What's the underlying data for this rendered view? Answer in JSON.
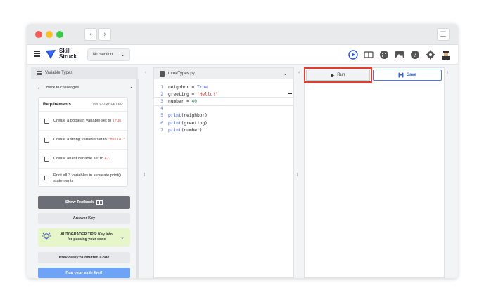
{
  "titlebar": {
    "back_glyph": "‹",
    "forward_glyph": "›",
    "menu_glyph": "☰"
  },
  "appbar": {
    "logo_line1": "Skill",
    "logo_line2": "Struck",
    "section_select": "No section",
    "brand_color": "#2250d8",
    "tool_icons": [
      "run-circle-icon",
      "book-icon",
      "palette-icon",
      "image-icon",
      "help-icon",
      "gear-icon",
      "avatar"
    ]
  },
  "left_panel": {
    "header": "Variable Types",
    "back_label": "Back to challenges",
    "requirements": {
      "title": "Requirements",
      "count": "0/4 COMPLETED",
      "items": [
        {
          "text": "Create a boolean variable set to ",
          "code": "True",
          "tail": "."
        },
        {
          "text": "Create a string variable set to ",
          "code": "\"Hello!\"",
          "tail": ""
        },
        {
          "text": "Create an int variable set to ",
          "code": "42",
          "tail": "."
        },
        {
          "text": "Print all 3 variables in separate print() statements",
          "code": "",
          "tail": ""
        }
      ]
    },
    "show_textbook": "Show Textbook",
    "answer_key": "Answer Key",
    "tips_line1": "AUTOGRADER TIPS: Key info",
    "tips_line2": "for passing your code",
    "previously_submitted": "Previously Submitted Code",
    "run_first": "Run your code first!"
  },
  "editor": {
    "filename": "threeTypes.py",
    "divider_glyph": "|:|",
    "lines": [
      {
        "n": "1",
        "parts": [
          [
            "",
            "neighbor = "
          ],
          [
            "kw",
            "True"
          ]
        ]
      },
      {
        "n": "2",
        "parts": [
          [
            "",
            "greeting = "
          ],
          [
            "str",
            "\"Hello!\""
          ]
        ]
      },
      {
        "n": "3",
        "parts": [
          [
            "",
            "number = "
          ],
          [
            "num",
            "40"
          ]
        ]
      },
      {
        "n": "4",
        "parts": []
      },
      {
        "n": "5",
        "parts": [
          [
            "fn",
            "print"
          ],
          [
            "",
            "(neighbor)"
          ]
        ]
      },
      {
        "n": "6",
        "parts": [
          [
            "fn",
            "print"
          ],
          [
            "",
            "(greeting)"
          ]
        ]
      },
      {
        "n": "7",
        "parts": [
          [
            "fn",
            "print"
          ],
          [
            "",
            "(number)"
          ]
        ]
      }
    ]
  },
  "output": {
    "run_label": "Run",
    "save_label": "Save",
    "highlight_color": "#e53b2c"
  }
}
